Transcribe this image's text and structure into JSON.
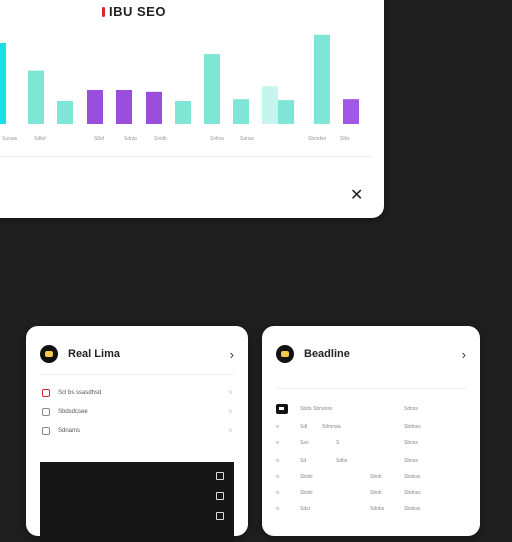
{
  "top_window": {
    "title": "IBU SEO",
    "close_glyph": "✕"
  },
  "chart_data": {
    "type": "bar",
    "categories": [
      "",
      "",
      "",
      "",
      "",
      "",
      "",
      "",
      "",
      "",
      "",
      ""
    ],
    "tick_labels": [
      "Sunaw",
      "Sdbd",
      "",
      "Slbd",
      "Sdnip",
      "Snidb",
      "",
      "Snlina",
      "Sanas",
      "",
      "Sbrsdsn",
      "Slbs"
    ],
    "values": [
      88,
      58,
      25,
      37,
      37,
      35,
      25,
      76,
      27,
      41,
      26,
      97,
      27
    ],
    "colors": [
      "#19e0e6",
      "#7fe6d6",
      "#7fe6d6",
      "#9a4fdc",
      "#9a4fdc",
      "#9a4fdc",
      "#7fe6d6",
      "#7fe6d6",
      "#7fe6d6",
      "#c6f5ee",
      "#7fe6d6",
      "#7fe6d6",
      "#a257e6"
    ],
    "ylim": [
      0,
      100
    ],
    "grid": false
  },
  "card_left": {
    "title": "Real Lima",
    "chevron": "›",
    "rows": [
      {
        "label": "Scl bs ssasdhsd",
        "meta": "o"
      },
      {
        "label": "Sbdsdcsee",
        "meta": "o"
      },
      {
        "label": "Sdnams",
        "meta": "o"
      }
    ]
  },
  "card_right": {
    "title": "Beadline",
    "chevron": "›",
    "header": {
      "c1": "Sbdo Sbnanss",
      "c3": "Sdnss"
    },
    "rows": [
      {
        "c0": "o",
        "c1": "Sdl",
        "c2": "Sdmnaa",
        "c3": "Sbdnss"
      },
      {
        "c0": "o",
        "c1": "Sso",
        "c2": "S",
        "c3": "Sbnss"
      },
      {
        "c0": "o",
        "c1": "Sd",
        "c2": "Sdbs",
        "c3": "Sbnss"
      },
      {
        "c0": "o",
        "c1": "Sbdsl",
        "c2": "Sbnb",
        "c3": "Sbdsss"
      },
      {
        "c0": "o",
        "c1": "Sbdsl",
        "c2": "Sbnb",
        "c3": "Sbdnss"
      },
      {
        "c0": "o",
        "c1": "Sdsl",
        "c2": "Sdnbs",
        "c3": "Sbdsss"
      }
    ]
  }
}
